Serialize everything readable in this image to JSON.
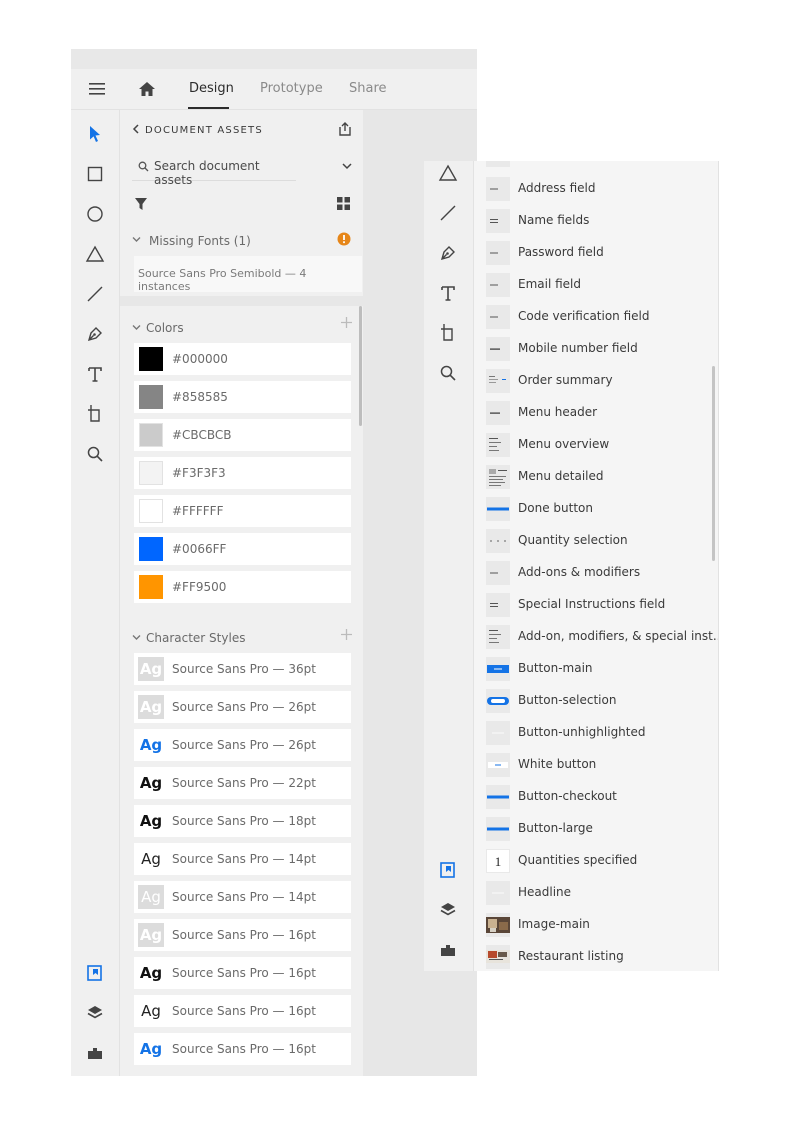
{
  "tabs": [
    {
      "label": "Design",
      "active": true
    },
    {
      "label": "Prototype",
      "active": false
    },
    {
      "label": "Share",
      "active": false
    }
  ],
  "assets": {
    "header": "DOCUMENT ASSETS",
    "search_placeholder": "Search document assets",
    "missing_fonts": {
      "label": "Missing Fonts (1)",
      "items": [
        "Source Sans Pro Semibold — 4 instances"
      ]
    },
    "colors": {
      "label": "Colors",
      "items": [
        {
          "hex": "#000000"
        },
        {
          "hex": "#858585"
        },
        {
          "hex": "#CBCBCB"
        },
        {
          "hex": "#F3F3F3"
        },
        {
          "hex": "#FFFFFF"
        },
        {
          "hex": "#0066FF"
        },
        {
          "hex": "#FF9500"
        }
      ]
    },
    "character_styles": {
      "label": "Character Styles",
      "items": [
        {
          "glyph": "Ag",
          "label": "Source Sans Pro — 36pt",
          "style": "muted"
        },
        {
          "glyph": "Ag",
          "label": "Source Sans Pro — 26pt",
          "style": "muted"
        },
        {
          "glyph": "Ag",
          "label": "Source Sans Pro — 26pt",
          "style": "blue"
        },
        {
          "glyph": "Ag",
          "label": "Source Sans Pro — 22pt",
          "style": "black"
        },
        {
          "glyph": "Ag",
          "label": "Source Sans Pro — 18pt",
          "style": "black"
        },
        {
          "glyph": "Ag",
          "label": "Source Sans Pro — 14pt",
          "style": "thin"
        },
        {
          "glyph": "Ag",
          "label": "Source Sans Pro — 14pt",
          "style": "thin-muted"
        },
        {
          "glyph": "Ag",
          "label": "Source Sans Pro — 16pt",
          "style": "muted"
        },
        {
          "glyph": "Ag",
          "label": "Source Sans Pro — 16pt",
          "style": "black"
        },
        {
          "glyph": "Ag",
          "label": "Source Sans Pro — 16pt",
          "style": "thin"
        },
        {
          "glyph": "Ag",
          "label": "Source Sans Pro — 16pt",
          "style": "blue"
        }
      ]
    }
  },
  "components": [
    {
      "label": "Address field",
      "thumb": "field"
    },
    {
      "label": "Name fields",
      "thumb": "name-field"
    },
    {
      "label": "Password field",
      "thumb": "field"
    },
    {
      "label": "Email field",
      "thumb": "field"
    },
    {
      "label": "Code verification field",
      "thumb": "field"
    },
    {
      "label": "Mobile number field",
      "thumb": "field-dark"
    },
    {
      "label": "Order summary",
      "thumb": "summary"
    },
    {
      "label": "Menu header",
      "thumb": "field-dark"
    },
    {
      "label": "Menu overview",
      "thumb": "overview"
    },
    {
      "label": "Menu detailed",
      "thumb": "detailed"
    },
    {
      "label": "Done button",
      "thumb": "blue-bar"
    },
    {
      "label": "Quantity selection",
      "thumb": "dots"
    },
    {
      "label": "Add-ons & modifiers",
      "thumb": "field"
    },
    {
      "label": "Special Instructions field",
      "thumb": "name-field"
    },
    {
      "label": "Add-on, modifiers, & special inst...",
      "thumb": "overview"
    },
    {
      "label": "Button-main",
      "thumb": "blue-block"
    },
    {
      "label": "Button-selection",
      "thumb": "blue-pill"
    },
    {
      "label": "Button-unhighlighted",
      "thumb": "light"
    },
    {
      "label": "White button",
      "thumb": "white-btn"
    },
    {
      "label": "Button-checkout",
      "thumb": "blue-bar"
    },
    {
      "label": "Button-large",
      "thumb": "blue-bar"
    },
    {
      "label": "Quantities specified",
      "thumb": "one"
    },
    {
      "label": "Headline",
      "thumb": "light"
    },
    {
      "label": "Image-main",
      "thumb": "photo"
    },
    {
      "label": "Restaurant listing",
      "thumb": "photo2"
    }
  ],
  "component_one_glyph": "1",
  "colors": {
    "accent": "#1473e6",
    "warning": "#e68619"
  }
}
